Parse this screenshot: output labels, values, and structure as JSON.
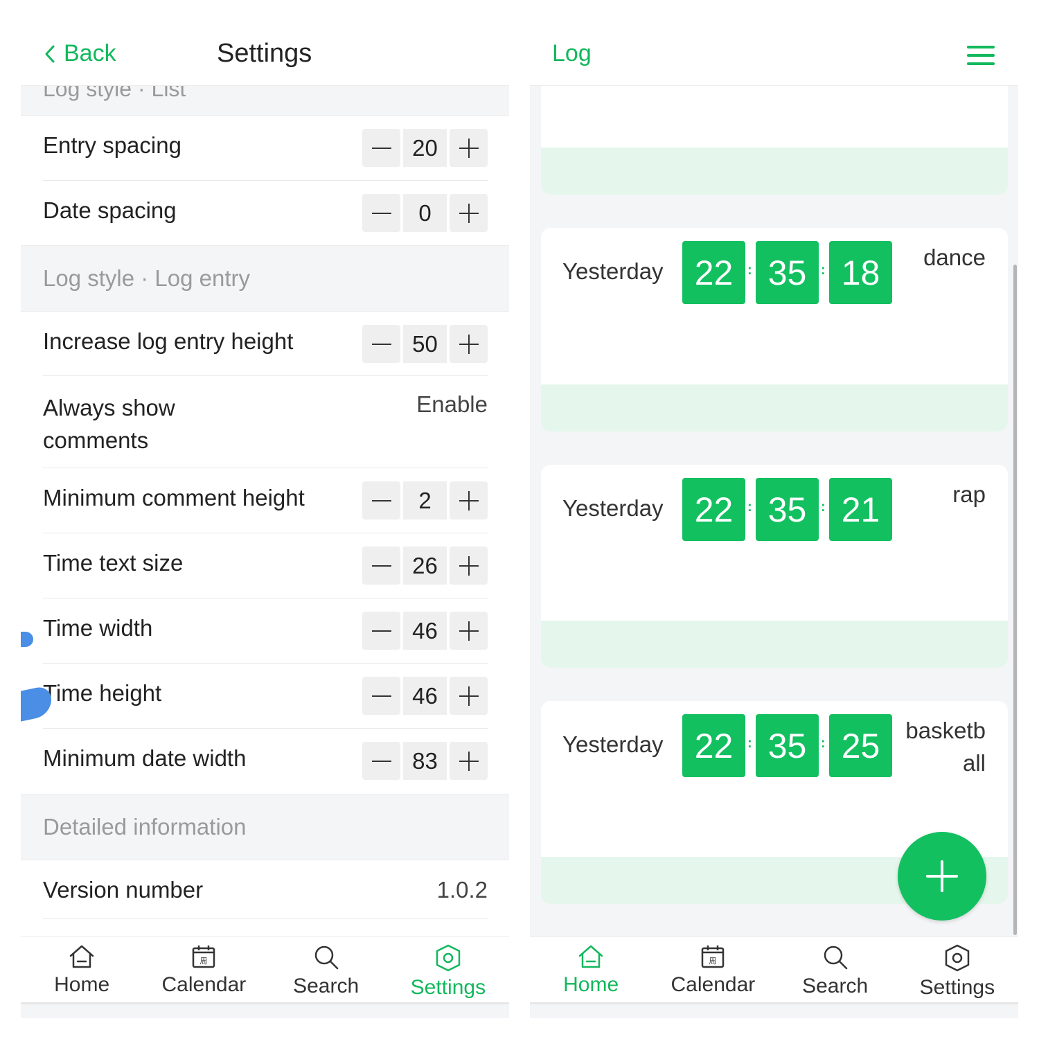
{
  "settings_screen": {
    "header": {
      "back_label": "Back",
      "title": "Settings"
    },
    "cutoff_text": "Log style · List",
    "rows_top": [
      {
        "label": "Entry spacing",
        "value": "20"
      },
      {
        "label": "Date spacing",
        "value": "0"
      }
    ],
    "section_log_entry": "Log style · Log entry",
    "increase_height": {
      "label": "Increase log entry height",
      "value": "50"
    },
    "always_show_comments": {
      "label": "Always show comments",
      "value": "Enable"
    },
    "rows_bottom": [
      {
        "label": "Minimum comment height",
        "value": "2"
      },
      {
        "label": "Time text size",
        "value": "26"
      },
      {
        "label": "Time width",
        "value": "46"
      },
      {
        "label": "Time height",
        "value": "46"
      },
      {
        "label": "Minimum date width",
        "value": "83"
      }
    ],
    "section_detailed": "Detailed information",
    "version": {
      "label": "Version number",
      "value": "1.0.2"
    }
  },
  "log_screen": {
    "header": {
      "title": "Log"
    },
    "entries": [
      {
        "date": "Yesterday",
        "hh": "22",
        "mm": "35",
        "ss": "18",
        "comment": "dance"
      },
      {
        "date": "Yesterday",
        "hh": "22",
        "mm": "35",
        "ss": "21",
        "comment": "rap"
      },
      {
        "date": "Yesterday",
        "hh": "22",
        "mm": "35",
        "ss": "25",
        "comment_line1": "basketb",
        "comment_line2": "all"
      }
    ]
  },
  "tabs": {
    "home": "Home",
    "calendar": "Calendar",
    "search": "Search",
    "settings": "Settings"
  },
  "calendar_icon_glyph": "周",
  "colors": {
    "accent": "#12c060",
    "accent_text": "#12b85c",
    "strip": "#e5f7ec",
    "background": "#f4f5f7"
  }
}
